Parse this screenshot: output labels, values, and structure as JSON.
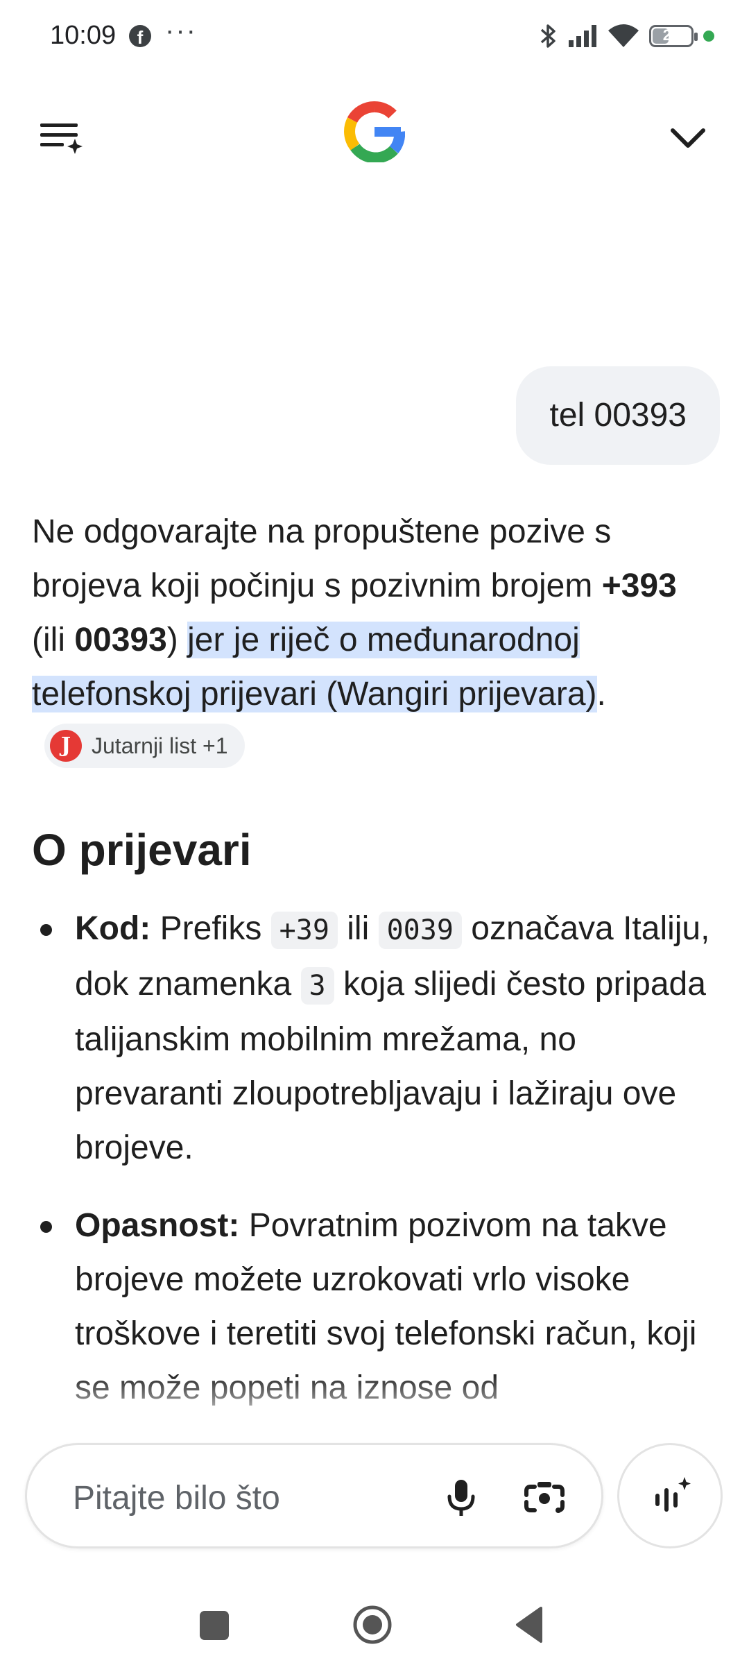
{
  "status_bar": {
    "time": "10:09",
    "app_icon": "facebook-icon",
    "overflow": "···",
    "battery_level": "20",
    "icons": [
      "bluetooth-icon",
      "signal-icon",
      "wifi-icon",
      "battery-icon"
    ]
  },
  "app_bar": {
    "menu_icon": "history-menu-icon",
    "logo": "google-g-logo",
    "chevron_icon": "chevron-down-icon"
  },
  "chat": {
    "user_query": "tel 00393",
    "answer": {
      "p1": "Ne odgovarajte na propuštene pozive s brojeva koji počinju s pozivnim brojem ",
      "b1": "+393",
      "p2": " (ili ",
      "b2": "00393",
      "p3": ") ",
      "highlight": "jer je riječ o međunarodnoj telefonskoj prijevari (Wangiri prijevara)",
      "p4": ".",
      "source_chip": {
        "label": "Jutarnji list +1",
        "logo_letter": "J"
      }
    },
    "section_heading": "O prijevari",
    "bullets": [
      {
        "label": "Kod:",
        "t1": " Prefiks ",
        "c1": "+39",
        "t2": " ili ",
        "c2": "0039",
        "t3": " označava Italiju, dok znamenka ",
        "c3": "3",
        "t4": " koja slijedi često pripada talijanskim mobilnim mrežama, no prevaranti zloupotrebljavaju i lažiraju ove brojeve."
      },
      {
        "label": "Opasnost:",
        "text": " Povratnim pozivom na takve brojeve možete uzrokovati vrlo visoke troškove i teretiti svoj telefonski račun, koji se može popeti na iznose od"
      }
    ]
  },
  "input": {
    "placeholder": "Pitajte bilo što"
  },
  "colors": {
    "highlight": "#d3e3fd",
    "chip_bg": "#f0f2f5",
    "source_logo": "#e53935"
  }
}
